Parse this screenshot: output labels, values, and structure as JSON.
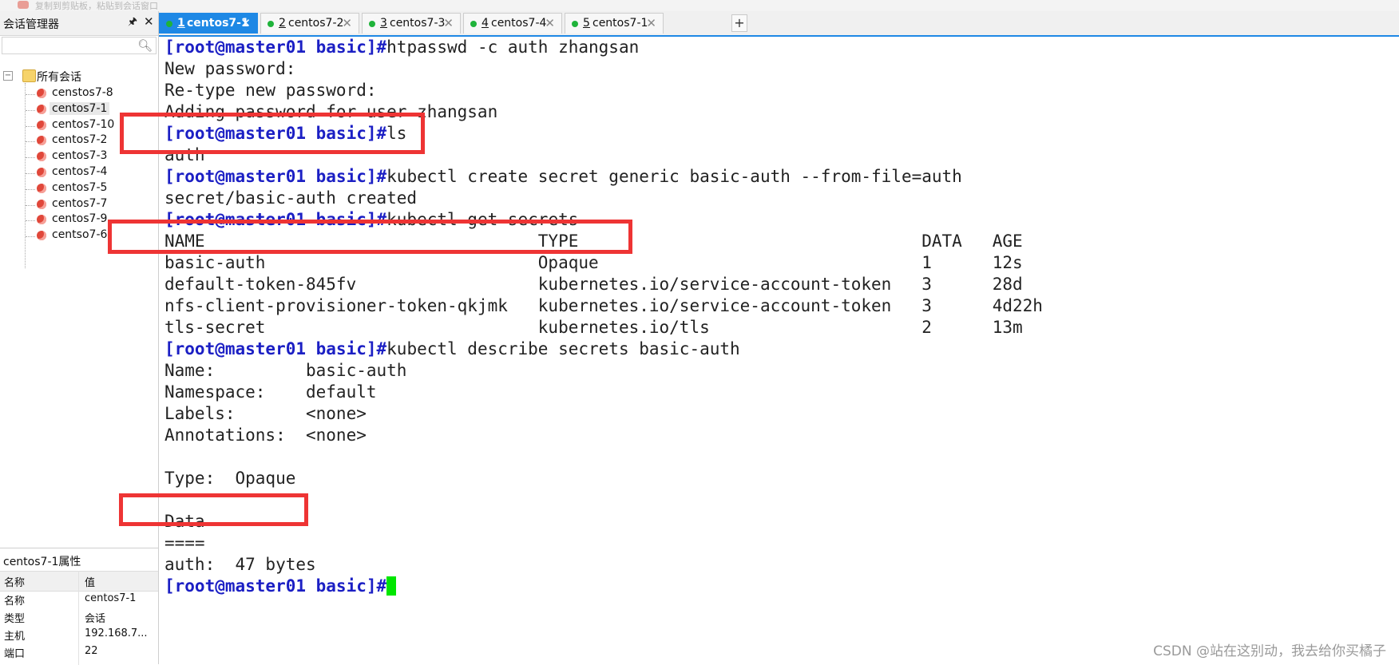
{
  "top_hint": "复制到剪贴板，粘贴到会话窗口",
  "sidebar": {
    "title": "会话管理器",
    "pin_icon": "pin-icon",
    "close_label": "✕",
    "root_label": "所有会话",
    "root_toggle": "−",
    "sessions": [
      "censtos7-8",
      "centos7-1",
      "centos7-10",
      "centos7-2",
      "centos7-3",
      "centos7-4",
      "centos7-5",
      "centos7-7",
      "centos7-9",
      "centso7-6"
    ],
    "selected": "centos7-1"
  },
  "properties": {
    "title": "centos7-1属性",
    "header_key": "名称",
    "header_value": "值",
    "rows": [
      {
        "k": "名称",
        "v": "centos7-1"
      },
      {
        "k": "类型",
        "v": "会话"
      },
      {
        "k": "主机",
        "v": "192.168.7..."
      },
      {
        "k": "端口",
        "v": "22"
      }
    ]
  },
  "tabs": [
    {
      "num": "1",
      "label": "centos7-1",
      "active": true
    },
    {
      "num": "2",
      "label": "centos7-2",
      "active": false
    },
    {
      "num": "3",
      "label": "centos7-3",
      "active": false
    },
    {
      "num": "4",
      "label": "centos7-4",
      "active": false
    },
    {
      "num": "5",
      "label": "centos7-1",
      "active": false
    }
  ],
  "add_tab_label": "+",
  "tab_close": "✕",
  "terminal": {
    "prompt": "[root@master01 basic]#",
    "lines": [
      {
        "prompt": true,
        "text": "htpasswd -c auth zhangsan"
      },
      {
        "prompt": false,
        "text": "New password:"
      },
      {
        "prompt": false,
        "text": "Re-type new password:"
      },
      {
        "prompt": false,
        "text": "Adding password for user zhangsan"
      },
      {
        "prompt": true,
        "text": "ls"
      },
      {
        "prompt": false,
        "text": "auth"
      },
      {
        "prompt": true,
        "text": "kubectl create secret generic basic-auth --from-file=auth"
      },
      {
        "prompt": false,
        "text": "secret/basic-auth created"
      },
      {
        "prompt": true,
        "text": "kubectl get secrets"
      },
      {
        "prompt": false,
        "text": "NAME                                 TYPE                                  DATA   AGE"
      },
      {
        "prompt": false,
        "text": "basic-auth                           Opaque                                1      12s"
      },
      {
        "prompt": false,
        "text": "default-token-845fv                  kubernetes.io/service-account-token   3      28d"
      },
      {
        "prompt": false,
        "text": "nfs-client-provisioner-token-qkjmk   kubernetes.io/service-account-token   3      4d22h"
      },
      {
        "prompt": false,
        "text": "tls-secret                           kubernetes.io/tls                     2      13m"
      },
      {
        "prompt": true,
        "text": "kubectl describe secrets basic-auth"
      },
      {
        "prompt": false,
        "text": "Name:         basic-auth"
      },
      {
        "prompt": false,
        "text": "Namespace:    default"
      },
      {
        "prompt": false,
        "text": "Labels:       <none>"
      },
      {
        "prompt": false,
        "text": "Annotations:  <none>"
      },
      {
        "prompt": false,
        "text": ""
      },
      {
        "prompt": false,
        "text": "Type:  Opaque"
      },
      {
        "prompt": false,
        "text": ""
      },
      {
        "prompt": false,
        "text": "Data"
      },
      {
        "prompt": false,
        "text": "===="
      },
      {
        "prompt": false,
        "text": "auth:  47 bytes"
      },
      {
        "prompt": true,
        "text": "",
        "cursor": true
      }
    ],
    "cursor_color": "#00e600",
    "prompt_color": "#1b1fc4"
  },
  "highlight_color": "#ee3434",
  "watermark": "CSDN @站在这别动，我去给你买橘子"
}
